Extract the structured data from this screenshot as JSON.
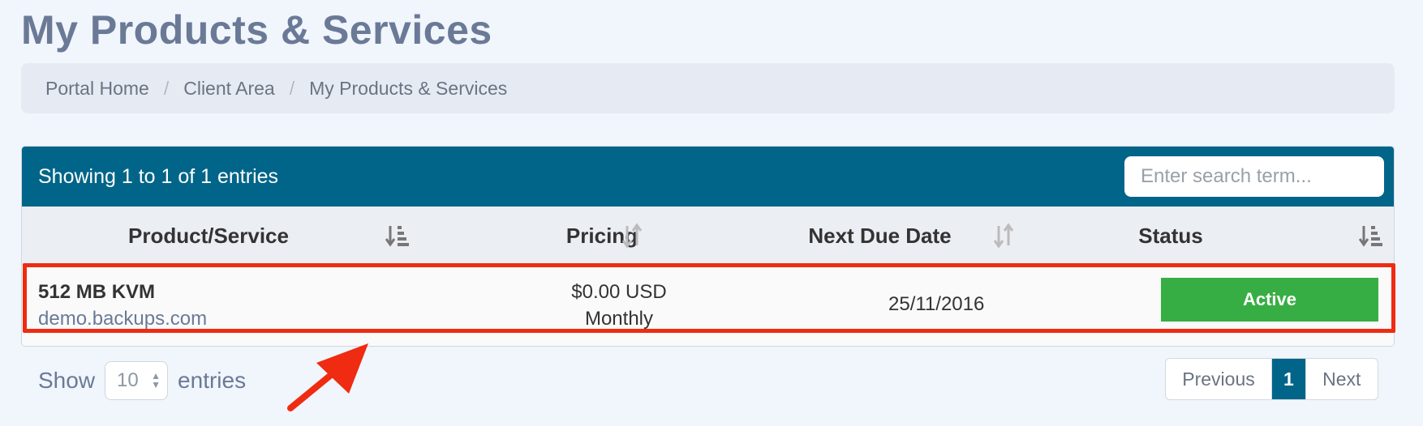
{
  "page": {
    "title": "My Products & Services"
  },
  "breadcrumb": {
    "items": [
      "Portal Home",
      "Client Area",
      "My Products & Services"
    ],
    "separator": "/"
  },
  "table": {
    "info": "Showing 1 to 1 of 1 entries",
    "search_placeholder": "Enter search term...",
    "columns": [
      {
        "label": "Product/Service",
        "sort": "sorted-desc-icon"
      },
      {
        "label": "Pricing",
        "sort": "sortable-icon"
      },
      {
        "label": "Next Due Date",
        "sort": "sortable-icon"
      },
      {
        "label": "Status",
        "sort": "sorted-desc-icon"
      }
    ],
    "rows": [
      {
        "product": "512 MB KVM",
        "domain": "demo.backups.com",
        "price": "$0.00 USD",
        "cycle": "Monthly",
        "due_date": "25/11/2016",
        "status": "Active"
      }
    ]
  },
  "length": {
    "prefix": "Show",
    "value": "10",
    "suffix": "entries"
  },
  "pagination": {
    "previous": "Previous",
    "current": "1",
    "next": "Next"
  },
  "colors": {
    "header_bg": "#006588",
    "status_active": "#37ae43",
    "highlight": "#ef2b12",
    "title": "#6a7a96"
  }
}
